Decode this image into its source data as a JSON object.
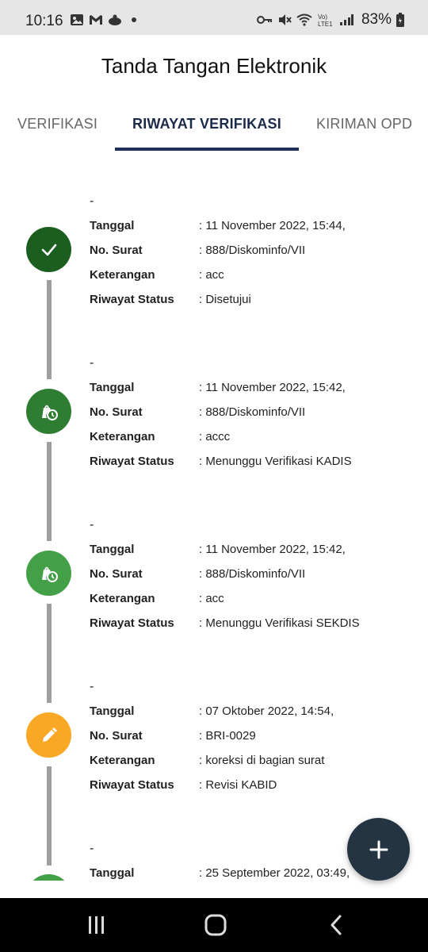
{
  "status_bar": {
    "time": "10:16",
    "battery": "83%",
    "icons": [
      "photo-icon",
      "gmail-icon",
      "app-icon",
      "dot-icon",
      "key-icon",
      "mute-icon",
      "wifi-icon",
      "volte-icon",
      "signal-icon",
      "battery-icon"
    ]
  },
  "app": {
    "title": "Tanda Tangan Elektronik"
  },
  "tabs": [
    {
      "label": "VERIFIKASI",
      "active": false
    },
    {
      "label": "RIWAYAT VERIFIKASI",
      "active": true
    },
    {
      "label": "KIRIMAN OPD",
      "active": false
    }
  ],
  "labels": {
    "tanggal": "Tanggal",
    "no_surat": "No. Surat",
    "keterangan": "Keterangan",
    "riwayat_status": "Riwayat Status"
  },
  "items": [
    {
      "title": "-",
      "tanggal": ": 11 November 2022, 15:44,",
      "no_surat": ": 888/Diskominfo/VII",
      "keterangan": ": acc",
      "status": ": Disetujui",
      "icon": "check-icon",
      "color": "#1b5e20"
    },
    {
      "title": "-",
      "tanggal": ": 11 November 2022, 15:42,",
      "no_surat": ": 888/Diskominfo/VII",
      "keterangan": ": accc",
      "status": ": Menunggu Verifikasi KADIS",
      "icon": "pending-icon",
      "color": "#2e7d32"
    },
    {
      "title": "-",
      "tanggal": ": 11 November 2022, 15:42,",
      "no_surat": ": 888/Diskominfo/VII",
      "keterangan": ": acc",
      "status": ": Menunggu Verifikasi SEKDIS",
      "icon": "pending-icon",
      "color": "#43a047"
    },
    {
      "title": "-",
      "tanggal": ": 07 Oktober 2022, 14:54,",
      "no_surat": ": BRI-0029",
      "keterangan": ": koreksi di bagian surat",
      "status": ": Revisi KABID",
      "icon": "edit-icon",
      "color": "#f9a825"
    },
    {
      "title": "-",
      "tanggal": ": 25 September 2022, 03:49,",
      "icon": "pending-icon",
      "color": "#43a047"
    }
  ],
  "fab": {
    "icon": "plus-icon"
  },
  "nav": {
    "icons": [
      "recent-apps-icon",
      "home-icon",
      "back-icon"
    ]
  }
}
